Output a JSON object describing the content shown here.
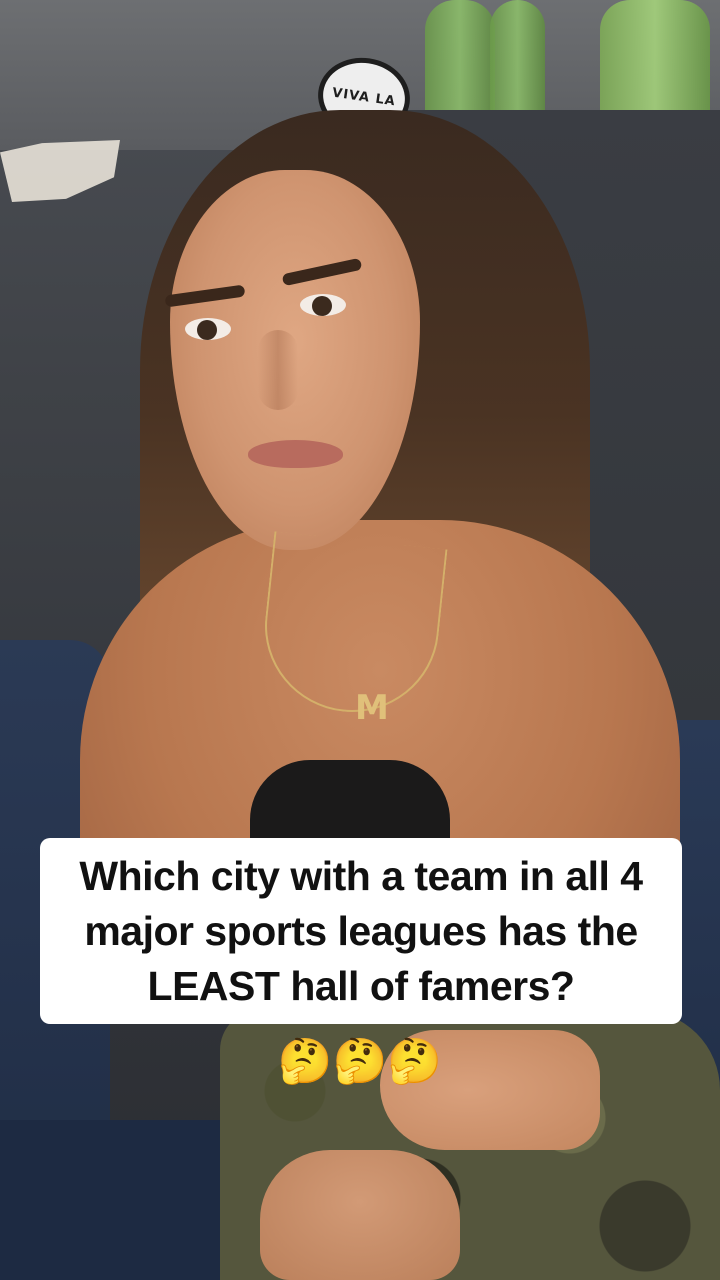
{
  "caption": {
    "text": "Which city with a team in all 4 major sports leagues has the LEAST hall of famers?"
  },
  "emoji_row": {
    "emoji": "🤔🤔🤔"
  },
  "background": {
    "logo_text": "VIVA LA"
  },
  "person": {
    "pendant_letter": "M"
  }
}
